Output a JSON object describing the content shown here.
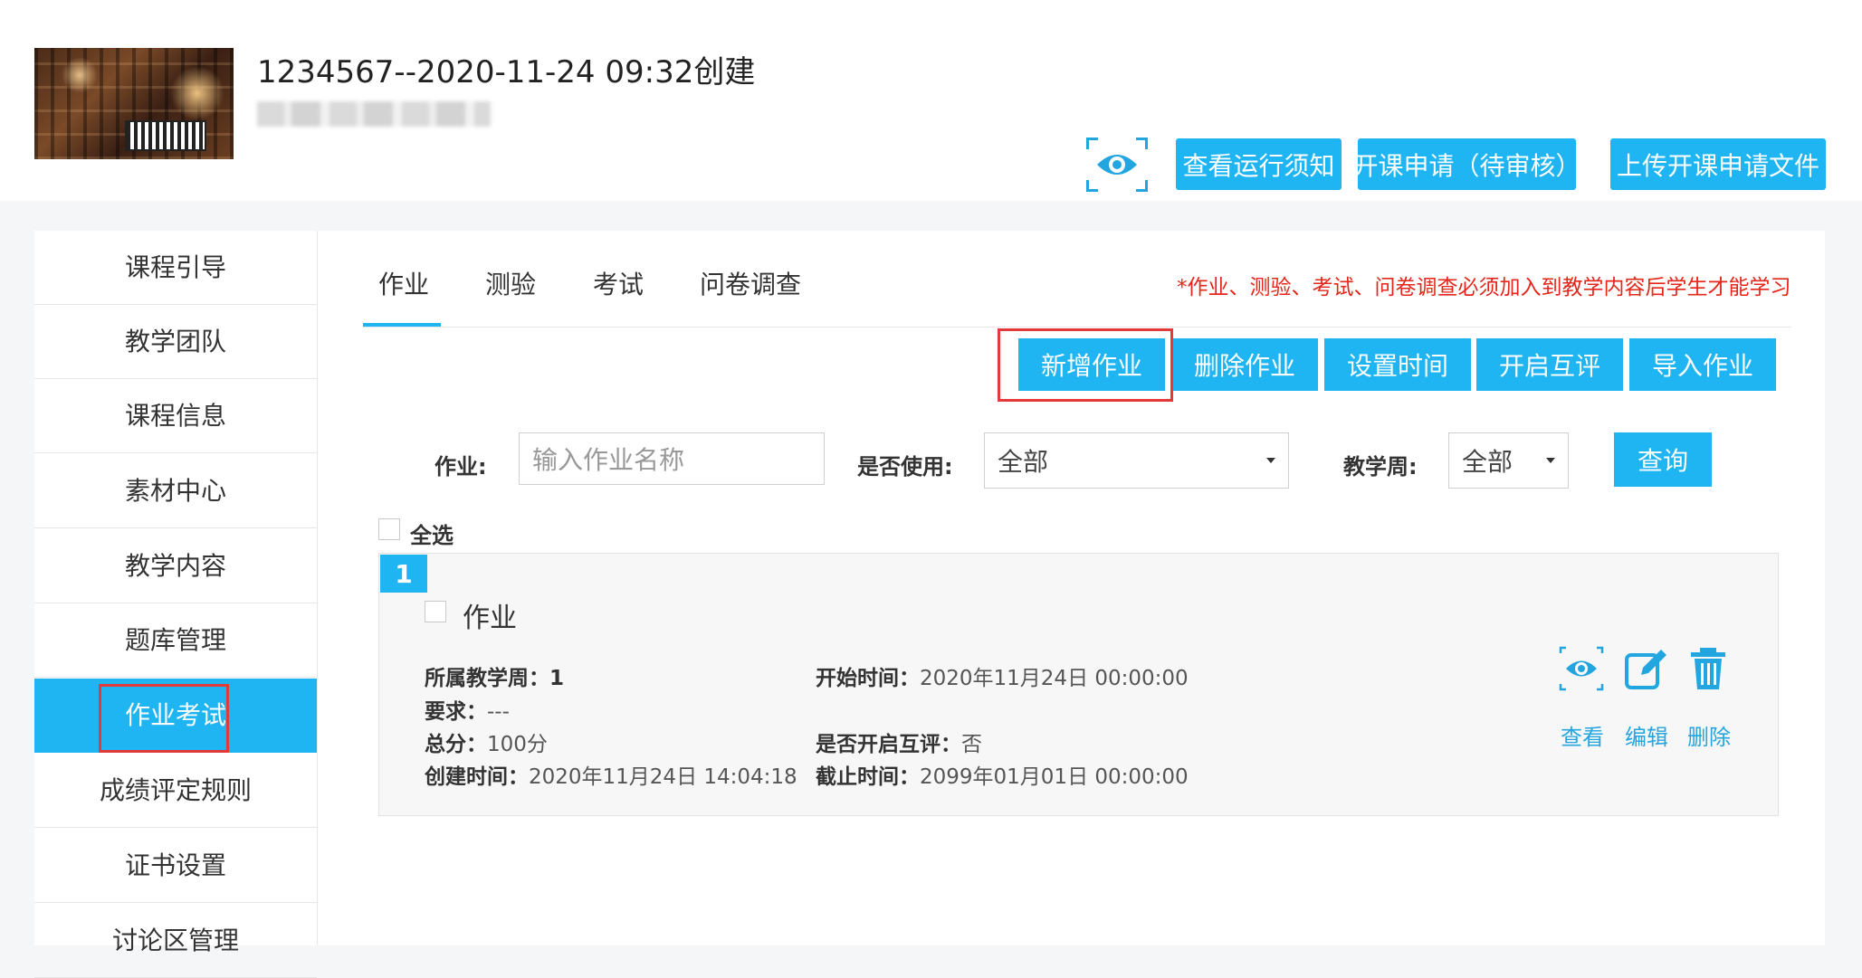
{
  "header": {
    "course_title": "1234567--2020-11-24 09:32创建",
    "buttons": {
      "view_notice": "查看运行须知",
      "open_apply": "开课申请（待审核）",
      "upload_apply": "上传开课申请文件"
    }
  },
  "sidebar": {
    "items": [
      {
        "label": "课程引导"
      },
      {
        "label": "教学团队"
      },
      {
        "label": "课程信息"
      },
      {
        "label": "素材中心"
      },
      {
        "label": "教学内容"
      },
      {
        "label": "题库管理"
      },
      {
        "label": "作业考试",
        "active": true
      },
      {
        "label": "成绩评定规则"
      },
      {
        "label": "证书设置"
      },
      {
        "label": "讨论区管理"
      }
    ]
  },
  "tabs": [
    {
      "label": "作业",
      "active": true
    },
    {
      "label": "测验"
    },
    {
      "label": "考试"
    },
    {
      "label": "问卷调查"
    }
  ],
  "notice": "*作业、测验、考试、问卷调查必须加入到教学内容后学生才能学习",
  "actions": {
    "add": "新增作业",
    "delete": "删除作业",
    "set_time": "设置时间",
    "enable_review": "开启互评",
    "import": "导入作业"
  },
  "filters": {
    "name_label": "作业:",
    "name_placeholder": "输入作业名称",
    "used_label": "是否使用:",
    "used_value": "全部",
    "week_label": "教学周:",
    "week_value": "全部",
    "query": "查询"
  },
  "select_all": "全选",
  "homework": {
    "index": "1",
    "title": "作业",
    "week_label": "所属教学周：",
    "week_value": "1",
    "req_label": "要求：",
    "req_value": "---",
    "score_label": "总分：",
    "score_value": "100分",
    "created_label": "创建时间：",
    "created_value": "2020年11月24日 14:04:18",
    "start_label": "开始时间：",
    "start_value": "2020年11月24日 00:00:00",
    "peer_label": "是否开启互评：",
    "peer_value": "否",
    "end_label": "截止时间：",
    "end_value": "2099年01月01日 00:00:00",
    "actions": {
      "view": "查看",
      "edit": "编辑",
      "delete": "删除"
    }
  },
  "colors": {
    "accent": "#1fb5f2",
    "highlight": "#e23a3a",
    "notice": "#e4261b"
  }
}
